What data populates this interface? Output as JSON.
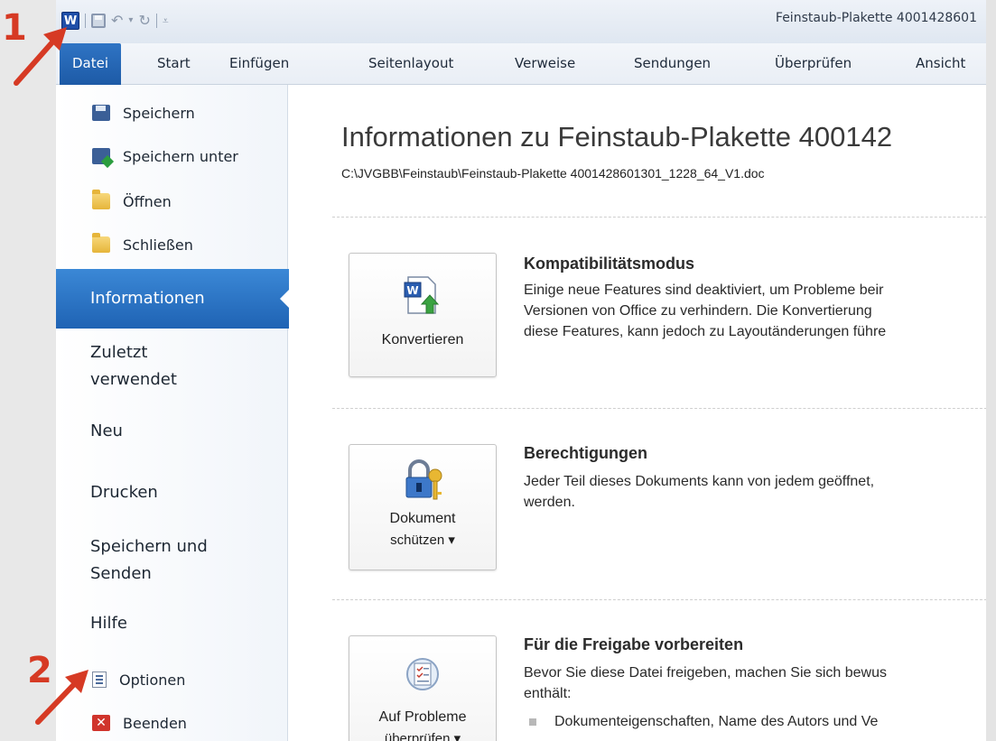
{
  "window": {
    "title": "Feinstaub-Plakette 4001428601",
    "app_icon": "W"
  },
  "quick_access": {
    "icons": [
      "word-icon",
      "save-icon",
      "undo-icon",
      "redo-icon",
      "customize-icon"
    ]
  },
  "ribbon": {
    "tabs": [
      {
        "label": "Datei"
      },
      {
        "label": "Start"
      },
      {
        "label": "Einfügen"
      },
      {
        "label": "Seitenlayout"
      },
      {
        "label": "Verweise"
      },
      {
        "label": "Sendungen"
      },
      {
        "label": "Überprüfen"
      },
      {
        "label": "Ansicht"
      }
    ]
  },
  "sidebar": {
    "small_items": [
      {
        "label": "Speichern",
        "icon": "save-icon"
      },
      {
        "label": "Speichern unter",
        "icon": "save-as-icon"
      },
      {
        "label": "Öffnen",
        "icon": "open-folder-icon"
      },
      {
        "label": "Schließen",
        "icon": "close-folder-icon"
      }
    ],
    "active": "Informationen",
    "big_items": [
      {
        "label_1": "Zuletzt",
        "label_2": "verwendet"
      },
      {
        "label_1": "Neu"
      },
      {
        "label_1": "Drucken"
      },
      {
        "label_1": "Speichern und",
        "label_2": "Senden"
      },
      {
        "label_1": "Hilfe"
      }
    ],
    "bottom_items": [
      {
        "label": "Optionen",
        "icon": "options-icon"
      },
      {
        "label": "Beenden",
        "icon": "exit-icon"
      }
    ]
  },
  "main": {
    "title": "Informationen zu Feinstaub-Plakette 400142",
    "path": "C:\\JVGBB\\Feinstaub\\Feinstaub-Plakette 4001428601301_1228_64_V1.doc",
    "sections": [
      {
        "button_label_1": "Konvertieren",
        "title": "Kompatibilitätsmodus",
        "lines": [
          "Einige neue Features sind deaktiviert, um Probleme beir",
          "Versionen von Office zu verhindern. Die Konvertierung",
          "diese Features, kann jedoch zu Layoutänderungen führe"
        ]
      },
      {
        "button_label_1": "Dokument",
        "button_label_2": "schützen ▾",
        "title": "Berechtigungen",
        "lines": [
          "Jeder Teil dieses Dokuments kann von jedem geöffnet,",
          "werden."
        ]
      },
      {
        "button_label_1": "Auf Probleme",
        "button_label_2": "überprüfen ▾",
        "title": "Für die Freigabe vorbereiten",
        "lines": [
          "Bevor Sie diese Datei freigeben, machen Sie sich bewus",
          "enthält:"
        ],
        "bullet": "Dokumenteigenschaften, Name des Autors und Ve"
      }
    ]
  },
  "annotations": {
    "marker_1": "1",
    "marker_2": "2",
    "color": "#d63a24"
  }
}
